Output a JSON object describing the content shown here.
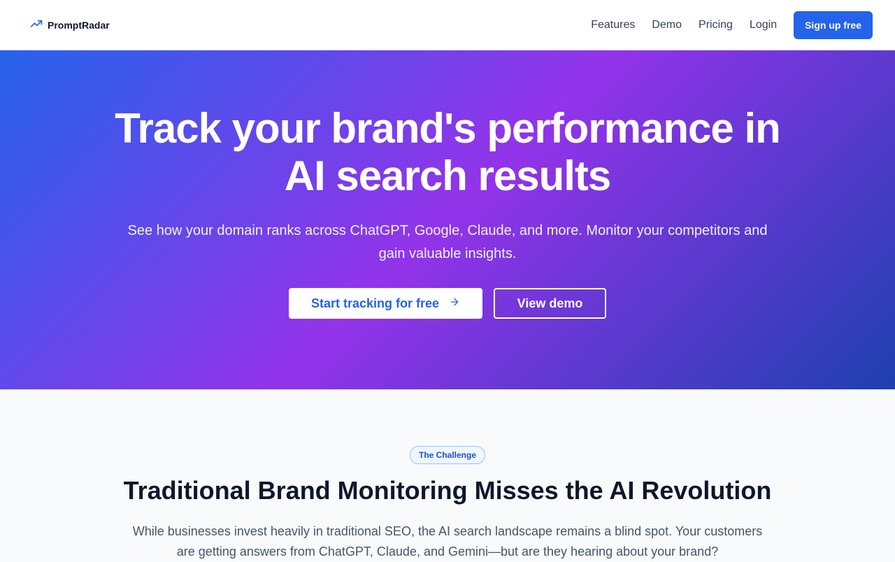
{
  "nav": {
    "brand": "PromptRadar",
    "brand_icon": "trending-up-icon",
    "links": [
      "Features",
      "Demo",
      "Pricing",
      "Login"
    ],
    "signup": "Sign up free"
  },
  "hero": {
    "title": "Track your brand's performance in AI search results",
    "subtitle": "See how your domain ranks across ChatGPT, Google, Claude, and more. Monitor your competitors and gain valuable insights.",
    "primary_cta": "Start tracking for free",
    "primary_cta_icon": "arrow-right-icon",
    "secondary_cta": "View demo"
  },
  "challenge": {
    "badge": "The Challenge",
    "title": "Traditional Brand Monitoring Misses the AI Revolution",
    "body": "While businesses invest heavily in traditional SEO, the AI search landscape remains a blind spot. Your customers are getting answers from ChatGPT, Claude, and Gemini—but are they hearing about your brand?"
  },
  "colors": {
    "accent": "#2563eb",
    "gradient_start": "#2563eb",
    "gradient_mid": "#9333ea",
    "gradient_end": "#1e40af"
  }
}
